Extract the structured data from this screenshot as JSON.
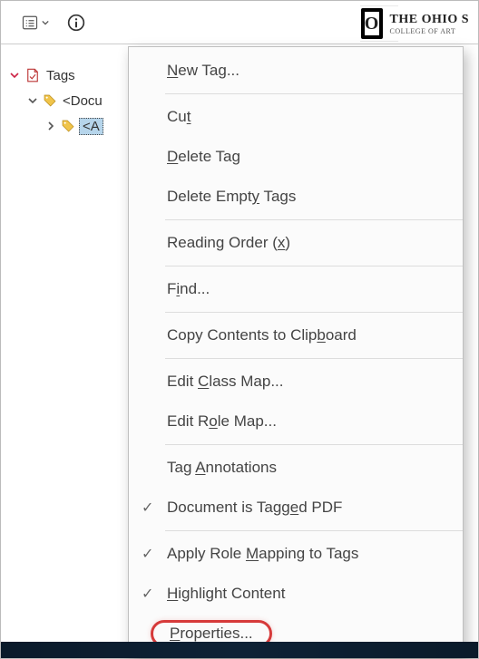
{
  "toolbar": {
    "tags_dropdown_tooltip": "Tags panel options",
    "info_tooltip": "Info"
  },
  "logo": {
    "o": "O",
    "main": "THE OHIO S",
    "sub": "COLLEGE OF ART"
  },
  "tree": {
    "root_label": "Tags",
    "level1_label": "<Docu",
    "level2_label": "<A"
  },
  "menu": {
    "items": [
      {
        "key": "new-tag",
        "label_pre": "",
        "label_u": "N",
        "label_post": "ew Tag...",
        "checked": false
      },
      {
        "sep": true
      },
      {
        "key": "cut",
        "label_pre": "Cu",
        "label_u": "t",
        "label_post": "",
        "checked": false
      },
      {
        "key": "delete-tag",
        "label_pre": "",
        "label_u": "D",
        "label_post": "elete Tag",
        "checked": false
      },
      {
        "key": "delete-empty",
        "label_pre": "Delete Empt",
        "label_u": "y",
        "label_post": " Tags",
        "checked": false
      },
      {
        "sep": true
      },
      {
        "key": "reading-order",
        "label_pre": "Reading Order (",
        "label_u": "x",
        "label_post": ")",
        "checked": false
      },
      {
        "sep": true
      },
      {
        "key": "find",
        "label_pre": "F",
        "label_u": "i",
        "label_post": "nd...",
        "checked": false
      },
      {
        "sep": true
      },
      {
        "key": "copy-clipboard",
        "label_pre": "Copy Contents to Clip",
        "label_u": "b",
        "label_post": "oard",
        "checked": false
      },
      {
        "sep": true
      },
      {
        "key": "edit-class-map",
        "label_pre": "Edit ",
        "label_u": "C",
        "label_post": "lass Map...",
        "checked": false
      },
      {
        "key": "edit-role-map",
        "label_pre": "Edit R",
        "label_u": "o",
        "label_post": "le Map...",
        "checked": false
      },
      {
        "sep": true
      },
      {
        "key": "tag-annots",
        "label_pre": "Tag ",
        "label_u": "A",
        "label_post": "nnotations",
        "checked": false
      },
      {
        "key": "doc-tagged",
        "label_pre": "Document is Tagg",
        "label_u": "e",
        "label_post": "d PDF",
        "checked": true
      },
      {
        "sep": true
      },
      {
        "key": "apply-role-map",
        "label_pre": "Apply Role ",
        "label_u": "M",
        "label_post": "apping to Tags",
        "checked": true
      },
      {
        "key": "highlight",
        "label_pre": "",
        "label_u": "H",
        "label_post": "ighlight Content",
        "checked": true
      },
      {
        "key": "properties",
        "label_pre": "",
        "label_u": "P",
        "label_post": "roperties...",
        "checked": false,
        "emphasis": true
      }
    ]
  }
}
